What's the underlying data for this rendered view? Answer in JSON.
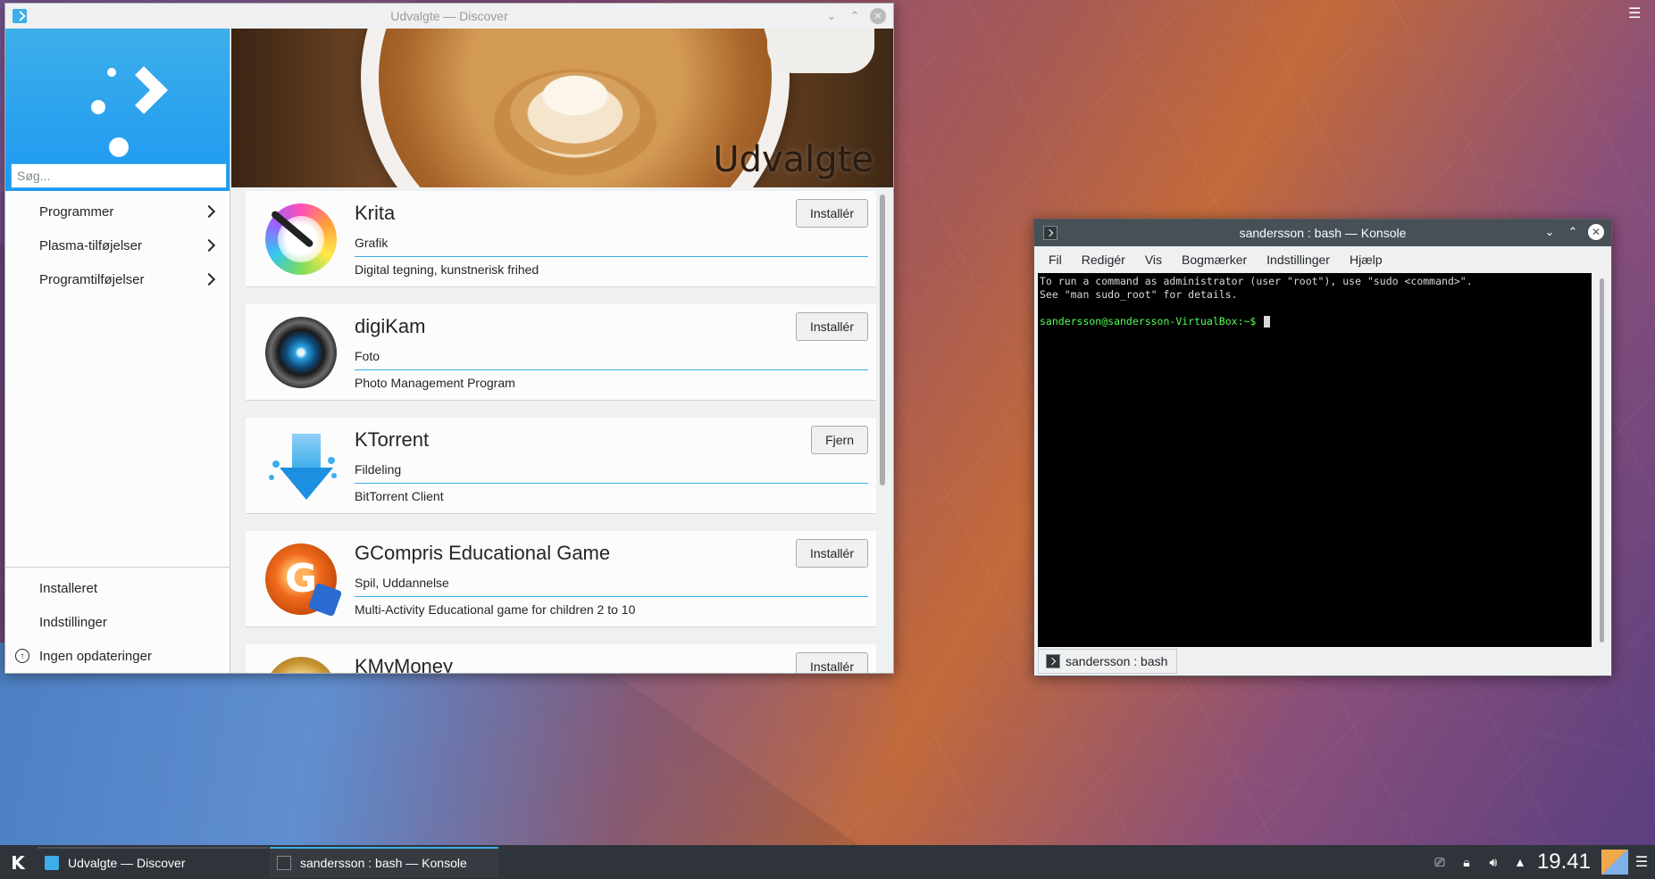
{
  "desktop": {
    "menu_icon": "hamburger-icon"
  },
  "discover": {
    "window_title": "Udvalgte — Discover",
    "search": {
      "placeholder": "Søg...",
      "value": ""
    },
    "nav": [
      {
        "label": "Programmer"
      },
      {
        "label": "Plasma-tilføjelser"
      },
      {
        "label": "Programtilføjelser"
      }
    ],
    "bottom_nav": [
      {
        "label": "Installeret"
      },
      {
        "label": "Indstillinger"
      },
      {
        "label": "Ingen opdateringer"
      }
    ],
    "banner_title": "Udvalgte",
    "apps": [
      {
        "name": "Krita",
        "category": "Grafik",
        "description": "Digital tegning, kunstnerisk frihed",
        "action": "Installér",
        "icon": "krita-icon"
      },
      {
        "name": "digiKam",
        "category": "Foto",
        "description": "Photo Management Program",
        "action": "Installér",
        "icon": "digikam-icon"
      },
      {
        "name": "KTorrent",
        "category": "Fildeling",
        "description": "BitTorrent Client",
        "action": "Fjern",
        "icon": "ktorrent-icon"
      },
      {
        "name": "GCompris Educational Game",
        "category": "Spil, Uddannelse",
        "description": "Multi-Activity Educational game for children 2 to 10",
        "action": "Installér",
        "icon": "gcompris-icon"
      },
      {
        "name": "KMyMoney",
        "category": "",
        "description": "",
        "action": "Installér",
        "icon": "kmymoney-icon"
      }
    ]
  },
  "konsole": {
    "window_title": "sandersson : bash — Konsole",
    "menu": [
      "Fil",
      "Redigér",
      "Vis",
      "Bogmærker",
      "Indstillinger",
      "Hjælp"
    ],
    "terminal": {
      "line1": "To run a command as administrator (user \"root\"), use \"sudo <command>\".",
      "line2": "See \"man sudo_root\" for details.",
      "prompt": "sandersson@sandersson-VirtualBox:~$ "
    },
    "tab_label": "sandersson : bash"
  },
  "taskbar": {
    "tasks": [
      {
        "label": "Udvalgte — Discover"
      },
      {
        "label": "sandersson : bash — Konsole"
      }
    ],
    "clock": "19.41"
  }
}
